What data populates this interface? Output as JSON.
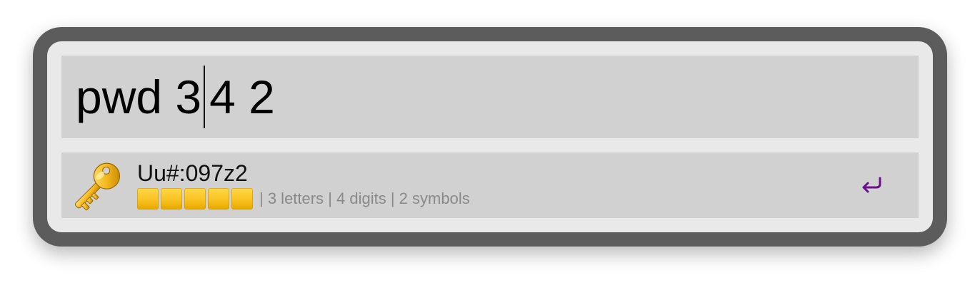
{
  "query": {
    "before_caret": "pwd 3",
    "after_caret": "4 2"
  },
  "result": {
    "icon": "key-icon",
    "title": "Uu#:097z2",
    "strength": {
      "filled": 5,
      "total": 5,
      "color": "#f9c220"
    },
    "subtitle": "| 3 letters | 4 digits | 2 symbols",
    "action_icon": "return-arrow-icon",
    "action_color": "#6a0f8e"
  },
  "colors": {
    "frame": "#5c5c5c",
    "panel": "#e9e9e9",
    "field": "#d1d1d1"
  }
}
